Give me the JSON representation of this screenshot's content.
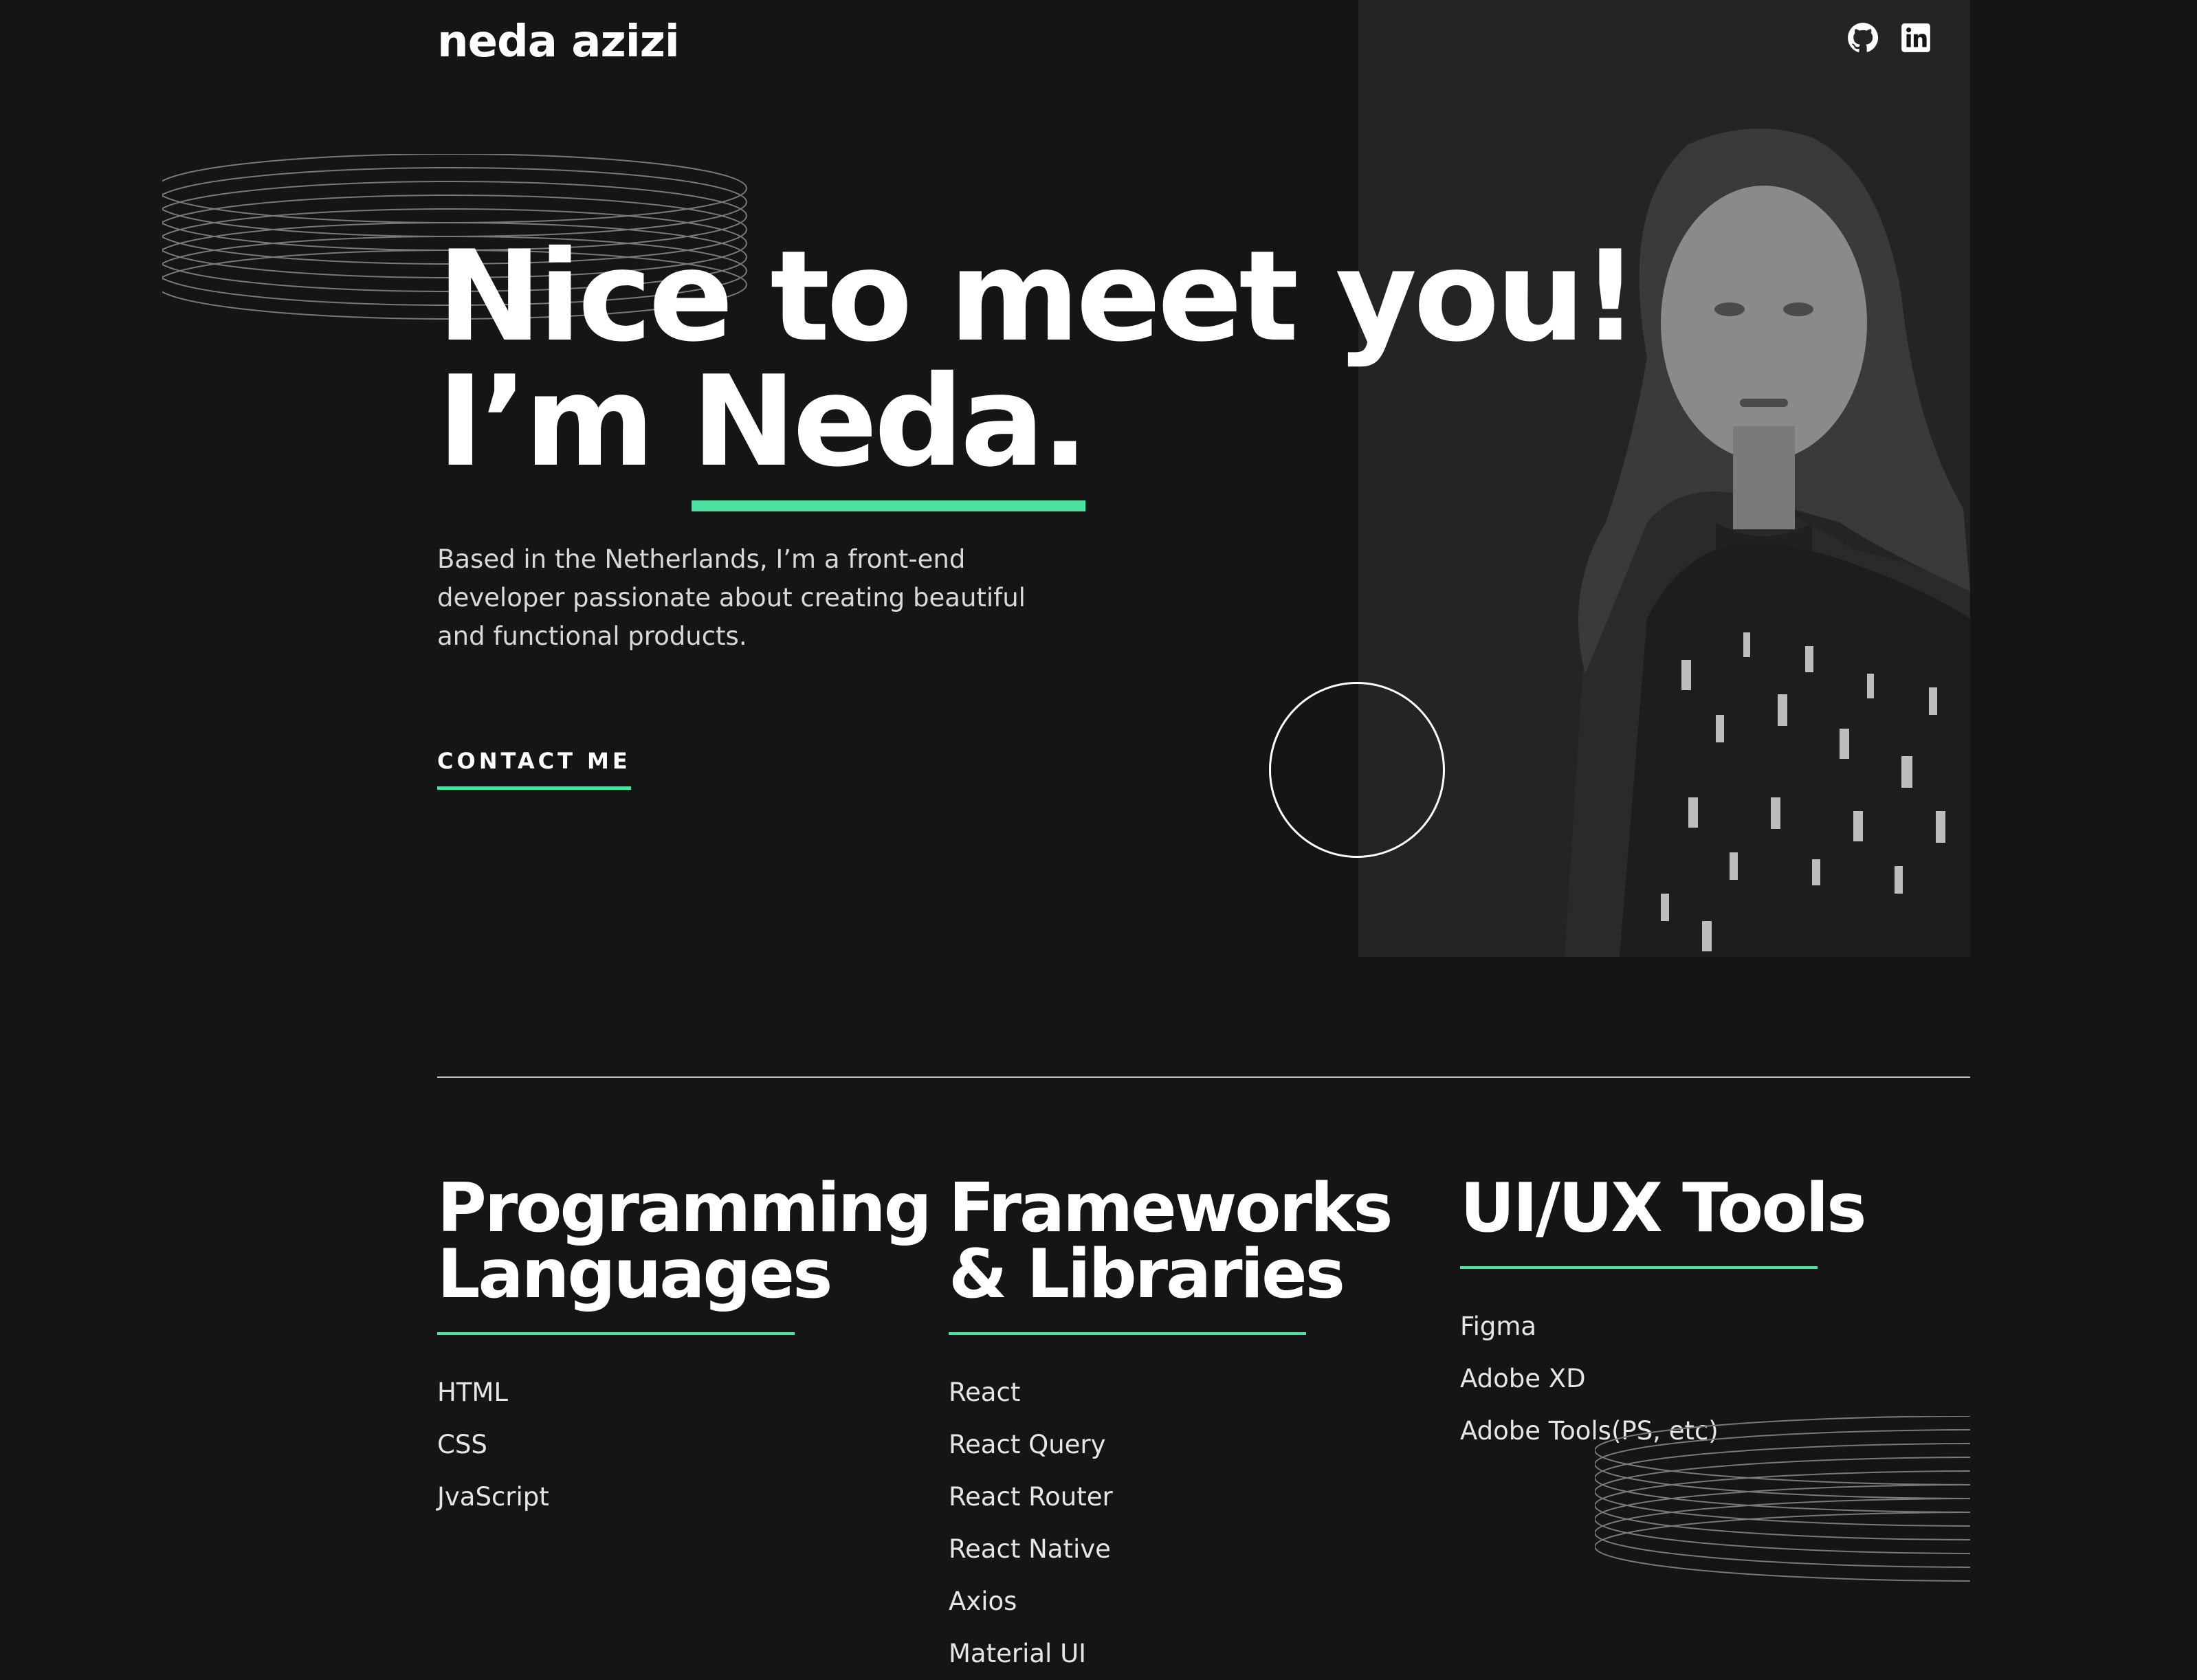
{
  "header": {
    "logo": "neda azizi",
    "social": [
      {
        "name": "github-icon"
      },
      {
        "name": "linkedin-icon"
      }
    ]
  },
  "hero": {
    "line1": "Nice to meet you!",
    "line2_prefix": "I’m ",
    "line2_name": "Neda.",
    "intro": "Based in the Netherlands, I’m a front-end developer passionate about creating beautiful and functional products.",
    "cta": "CONTACT ME"
  },
  "skills": [
    {
      "title": "Programming Languages",
      "items": [
        "HTML",
        "CSS",
        "JvaScript"
      ]
    },
    {
      "title": "Frameworks & Libraries",
      "items": [
        "React",
        "React Query",
        "React Router",
        "React Native",
        "Axios",
        "Material UI"
      ]
    },
    {
      "title": "UI/UX Tools",
      "items": [
        "Figma",
        "Adobe XD",
        "Adobe Tools(PS, etc)"
      ]
    }
  ],
  "colors": {
    "background": "#151515",
    "panel": "#242424",
    "accent": "#4ee1a0",
    "text": "#ffffff"
  }
}
